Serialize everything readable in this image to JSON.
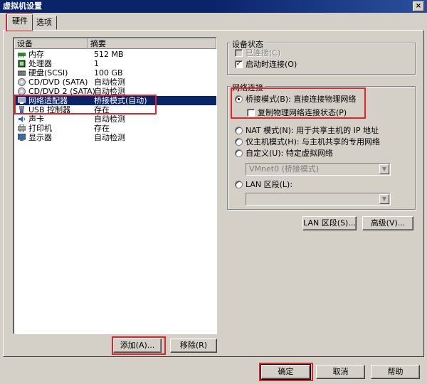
{
  "window": {
    "title": "虚拟机设置",
    "close_glyph": "×"
  },
  "tabs": [
    {
      "label": "硬件",
      "active": true
    },
    {
      "label": "选项",
      "active": false
    }
  ],
  "device_list": {
    "headers": {
      "device": "设备",
      "summary": "摘要"
    },
    "rows": [
      {
        "name": "内存",
        "summary": "512 MB",
        "icon": "memory-icon"
      },
      {
        "name": "处理器",
        "summary": "1",
        "icon": "processor-icon"
      },
      {
        "name": "硬盘(SCSI)",
        "summary": "100 GB",
        "icon": "hard-disk-icon"
      },
      {
        "name": "CD/DVD (SATA)",
        "summary": "自动检测",
        "icon": "cd-dvd-icon"
      },
      {
        "name": "CD/DVD 2 (SATA)",
        "summary": "自动检测",
        "icon": "cd-dvd-icon"
      },
      {
        "name": "网络适配器",
        "summary": "桥接模式(自动)",
        "icon": "network-adapter-icon",
        "selected": true
      },
      {
        "name": "USB 控制器",
        "summary": "存在",
        "icon": "usb-icon"
      },
      {
        "name": "声卡",
        "summary": "自动检测",
        "icon": "sound-card-icon"
      },
      {
        "name": "打印机",
        "summary": "存在",
        "icon": "printer-icon"
      },
      {
        "name": "显示器",
        "summary": "自动检测",
        "icon": "monitor-icon"
      }
    ]
  },
  "list_buttons": {
    "add": "添加(A)...",
    "remove": "移除(R)"
  },
  "device_status": {
    "title": "设备状态",
    "connected": {
      "label": "已连接(C)",
      "checked": false,
      "disabled": true
    },
    "connect_at_power_on": {
      "label": "启动时连接(O)",
      "checked": true
    }
  },
  "network": {
    "title": "网络连接",
    "bridged": {
      "label": "桥接模式(B): 直接连接物理网络",
      "checked": true
    },
    "replicate": {
      "label": "复制物理网络连接状态(P)",
      "checked": false
    },
    "nat": {
      "label": "NAT 模式(N): 用于共享主机的 IP 地址"
    },
    "host_only": {
      "label": "仅主机模式(H): 与主机共享的专用网络"
    },
    "custom": {
      "label": "自定义(U): 特定虚拟网络",
      "combo_value": "VMnet0 (桥接模式)"
    },
    "lan_segment": {
      "label": "LAN 区段(L):",
      "combo_value": ""
    }
  },
  "right_buttons": {
    "lan_segment": "LAN 区段(S)...",
    "advanced": "高级(V)..."
  },
  "dialog_buttons": {
    "ok": "确定",
    "cancel": "取消",
    "help": "帮助"
  },
  "check_glyph": "✓",
  "arrow_glyph": "▼",
  "colors": {
    "selection": "#0a246a",
    "highlight_box": "#e0242a",
    "face": "#d4d0c8"
  }
}
